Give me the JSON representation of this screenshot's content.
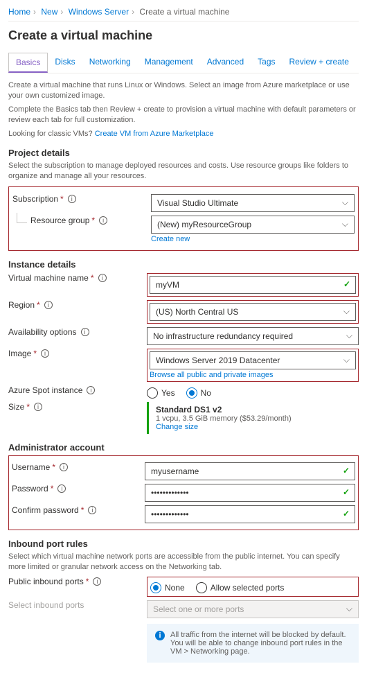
{
  "breadcrumb": {
    "items": [
      "Home",
      "New",
      "Windows Server"
    ],
    "current": "Create a virtual machine"
  },
  "title": "Create a virtual machine",
  "tabs": [
    "Basics",
    "Disks",
    "Networking",
    "Management",
    "Advanced",
    "Tags",
    "Review + create"
  ],
  "intro": {
    "line1": "Create a virtual machine that runs Linux or Windows. Select an image from Azure marketplace or use your own customized image.",
    "line2": "Complete the Basics tab then Review + create to provision a virtual machine with default parameters or review each tab for full customization.",
    "line3_prefix": "Looking for classic VMs? ",
    "line3_link": "Create VM from Azure Marketplace"
  },
  "projectDetails": {
    "heading": "Project details",
    "desc": "Select the subscription to manage deployed resources and costs. Use resource groups like folders to organize and manage all your resources.",
    "subscription": {
      "label": "Subscription",
      "value": "Visual Studio Ultimate"
    },
    "resourceGroup": {
      "label": "Resource group",
      "value": "(New) myResourceGroup",
      "createNew": "Create new"
    }
  },
  "instanceDetails": {
    "heading": "Instance details",
    "vmName": {
      "label": "Virtual machine name",
      "value": "myVM"
    },
    "region": {
      "label": "Region",
      "value": "(US) North Central US"
    },
    "availability": {
      "label": "Availability options",
      "value": "No infrastructure redundancy required"
    },
    "image": {
      "label": "Image",
      "value": "Windows Server 2019 Datacenter",
      "browse": "Browse all public and private images"
    },
    "spot": {
      "label": "Azure Spot instance",
      "yes": "Yes",
      "no": "No",
      "selected": "no"
    },
    "size": {
      "label": "Size",
      "name": "Standard DS1 v2",
      "detail": "1 vcpu, 3.5 GiB memory ($53.29/month)",
      "change": "Change size"
    }
  },
  "admin": {
    "heading": "Administrator account",
    "username": {
      "label": "Username",
      "value": "myusername"
    },
    "password": {
      "label": "Password",
      "masked": "•••••••••••••"
    },
    "confirm": {
      "label": "Confirm password",
      "masked": "•••••••••••••"
    }
  },
  "ports": {
    "heading": "Inbound port rules",
    "desc": "Select which virtual machine network ports are accessible from the public internet. You can specify more limited or granular network access on the Networking tab.",
    "publicInbound": {
      "label": "Public inbound ports",
      "none": "None",
      "allow": "Allow selected ports",
      "selected": "none"
    },
    "selectInbound": {
      "label": "Select inbound ports",
      "placeholder": "Select one or more ports"
    },
    "info": "All traffic from the internet will be blocked by default. You will be able to change inbound port rules in the VM > Networking page."
  }
}
